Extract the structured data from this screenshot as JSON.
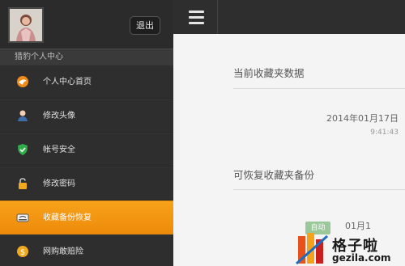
{
  "sidebar": {
    "logout_label": "退出",
    "section_label": "猎豹个人中心",
    "items": [
      {
        "label": "个人中心首页",
        "icon": "cheetah-logo-icon",
        "active": false
      },
      {
        "label": "修改头像",
        "icon": "user-avatar-icon",
        "active": false
      },
      {
        "label": "帐号安全",
        "icon": "shield-check-icon",
        "active": false
      },
      {
        "label": "修改密码",
        "icon": "padlock-icon",
        "active": false
      },
      {
        "label": "收藏备份恢复",
        "icon": "favorites-backup-icon",
        "active": true
      },
      {
        "label": "网购敢赔险",
        "icon": "coin-icon",
        "active": false
      }
    ]
  },
  "topbar": {
    "menu_icon": "hamburger-menu-icon"
  },
  "main": {
    "current_title": "当前收藏夹数据",
    "current_date": "2014年01月17日",
    "current_time": "9:41:43",
    "recover_title": "可恢复收藏夹备份",
    "backup_tag": "自动",
    "backup_date": "01月1"
  },
  "watermark": {
    "cn": "格子啦",
    "en": "gezila.com"
  },
  "colors": {
    "sidebar": "#2e2e2e",
    "active": "#f39b14",
    "content": "#f4f4f4"
  }
}
